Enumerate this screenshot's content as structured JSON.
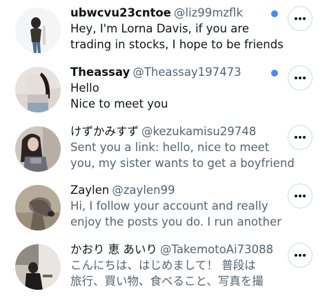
{
  "conversations": [
    {
      "name": "ubwcvu23cntoe",
      "handle": "@liz99mzflk",
      "lines": [
        "Hey, I'm Lorna Davis, if you are",
        "trading in stocks, I hope to be friends"
      ],
      "unread": true
    },
    {
      "name": "Theassay",
      "handle": "@Theassay197473",
      "lines": [
        "Hello",
        "Nice to meet you"
      ],
      "unread": true
    },
    {
      "name": "けずかみすず",
      "handle": "@kezukamisu29748",
      "lines": [
        "Sent you a link: hello, nice to meet",
        "you, my sister wants to get a boyfriend"
      ],
      "unread": false
    },
    {
      "name": "Zaylen",
      "handle": "@zaylen99",
      "lines": [
        "Hi, I follow your account and really",
        "enjoy the posts you do. I run another"
      ],
      "unread": false
    },
    {
      "name": "かおり 恵 あいり",
      "handle": "@TakemotoAi73088",
      "lines": [
        "こんにちは、はじめまして！ 普段は",
        "旅行、買い物、食べること、写真を撮"
      ],
      "unread": false
    }
  ],
  "icons": {
    "more": "more-horizontal-icon",
    "unread": "unread-dot"
  },
  "colors": {
    "unread_dot": "#4c8cf0",
    "secondary_text": "#536471",
    "primary_text": "#0f1419"
  }
}
